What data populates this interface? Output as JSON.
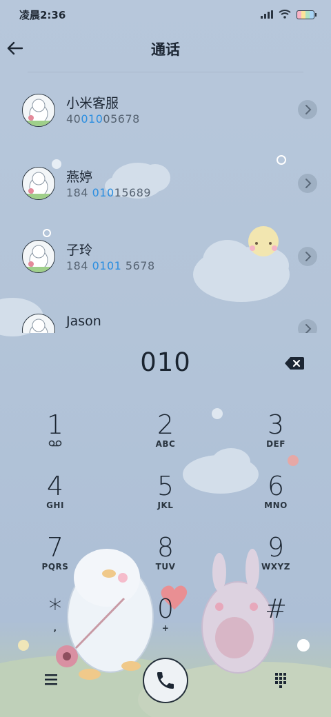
{
  "status_bar": {
    "time": "凌晨2:36",
    "icons": [
      "signal-icon",
      "wifi-icon",
      "battery-icon"
    ]
  },
  "header": {
    "title": "通话",
    "back_icon": "back-arrow-icon"
  },
  "contacts": [
    {
      "name": "小米客服",
      "number_pre": "40",
      "number_hl": "010",
      "number_post": "05678"
    },
    {
      "name": "燕婷",
      "number_pre": "184 ",
      "number_hl": "010",
      "number_post": "15689"
    },
    {
      "name": "子玲",
      "number_pre": "184 ",
      "number_hl": "0101",
      "number_post": " 5678"
    },
    {
      "name": "Jason",
      "number_pre": "",
      "number_hl": "",
      "number_post": ""
    }
  ],
  "dialer": {
    "entered": "010",
    "keys": [
      {
        "digit": "1",
        "letters": ""
      },
      {
        "digit": "2",
        "letters": "ABC"
      },
      {
        "digit": "3",
        "letters": "DEF"
      },
      {
        "digit": "4",
        "letters": "GHI"
      },
      {
        "digit": "5",
        "letters": "JKL"
      },
      {
        "digit": "6",
        "letters": "MNO"
      },
      {
        "digit": "7",
        "letters": "PQRS"
      },
      {
        "digit": "8",
        "letters": "TUV"
      },
      {
        "digit": "9",
        "letters": "WXYZ"
      },
      {
        "digit": "*",
        "letters": ","
      },
      {
        "digit": "0",
        "letters": "+"
      },
      {
        "digit": "#",
        "letters": ""
      }
    ]
  },
  "colors": {
    "highlight": "#2b8ee0",
    "background": "#b3c4d8",
    "text": "#1c2633"
  }
}
